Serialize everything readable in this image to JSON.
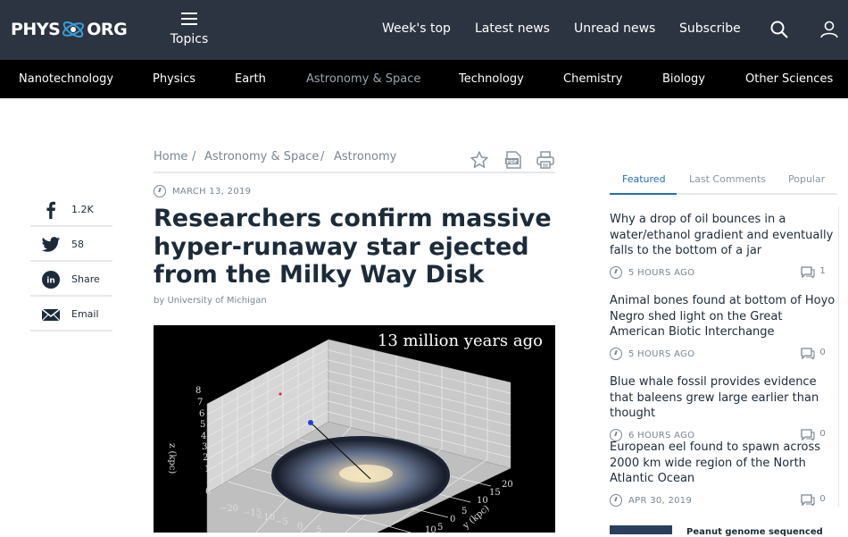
{
  "brand": {
    "logo_left": "PHYS",
    "logo_right": "ORG"
  },
  "header": {
    "topics_label": "Topics",
    "nav": [
      "Week's top",
      "Latest news",
      "Unread news",
      "Subscribe"
    ],
    "icons": [
      "search-icon",
      "user-icon"
    ],
    "background_color": "#2b3440"
  },
  "categories": {
    "items": [
      "Nanotechnology",
      "Physics",
      "Earth",
      "Astronomy & Space",
      "Technology",
      "Chemistry",
      "Biology",
      "Other Sciences"
    ],
    "active": "Astronomy & Space",
    "background_color": "#000000"
  },
  "share": {
    "items": [
      {
        "icon": "facebook-icon",
        "label": "1.2K"
      },
      {
        "icon": "twitter-icon",
        "label": "58"
      },
      {
        "icon": "linkedin-icon",
        "label": "Share"
      },
      {
        "icon": "email-icon",
        "label": "Email"
      }
    ]
  },
  "breadcrumb": {
    "items": [
      "Home",
      "Astronomy & Space",
      "Astronomy"
    ],
    "separator": "/",
    "icons": [
      "star-icon",
      "pdf-icon",
      "print-icon"
    ]
  },
  "article": {
    "date": "MARCH 13, 2019",
    "title_lines": [
      "Researchers confirm massive",
      "hyper-runaway star ejected",
      "from the Milky Way Disk"
    ],
    "byline": "by University of Michigan"
  },
  "figure": {
    "caption_in_image": "13 million years ago",
    "z_axis_label": "z (kpc)",
    "y_axis_label": "y (kpc)",
    "z_ticks": [
      "8",
      "7",
      "6",
      "5",
      "4",
      "3",
      "2",
      "1",
      "0"
    ],
    "x_ticks": [
      "−20",
      "−15",
      "−10",
      "−5",
      "0",
      "5"
    ],
    "y_ticks": [
      "20",
      "15",
      "10",
      "5",
      "0",
      "5",
      "10"
    ]
  },
  "sidebar": {
    "tabs": [
      "Featured",
      "Last Comments",
      "Popular"
    ],
    "active_tab": "Featured",
    "accent_color": "#1f6fb8",
    "items": [
      {
        "title": "Why a drop of oil bounces in a water/ethanol gradient and eventually falls to the bottom of a jar",
        "time": "5 HOURS AGO",
        "comments": "1"
      },
      {
        "title": "Animal bones found at bottom of Hoyo Negro shed light on the Great American Biotic Interchange",
        "time": "5 HOURS AGO",
        "comments": "0"
      },
      {
        "title": "Blue whale fossil provides evidence that baleens grew large earlier than thought",
        "time": "6 HOURS AGO",
        "comments": "0"
      },
      {
        "title": "European eel found to spawn across 2000 km wide region of the North Atlantic Ocean",
        "time": "APR 30, 2019",
        "comments": "0"
      }
    ],
    "next_item_title": "Peanut genome sequenced"
  }
}
